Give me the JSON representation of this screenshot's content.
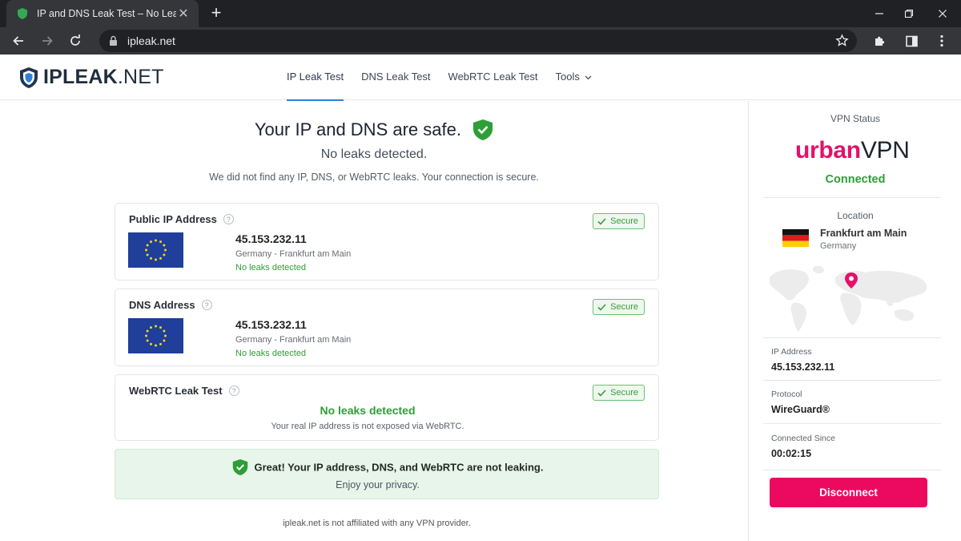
{
  "browser": {
    "tab_title": "IP and DNS Leak Test – No Leaks",
    "url": "ipleak.net"
  },
  "site": {
    "logo_prefix": "IPLEAK",
    "logo_suffix": ".NET",
    "nav": [
      {
        "label": "IP Leak Test",
        "active": true
      },
      {
        "label": "DNS Leak Test",
        "active": false
      },
      {
        "label": "WebRTC Leak Test",
        "active": false
      },
      {
        "label": "Tools",
        "active": false,
        "has_dropdown": true
      }
    ]
  },
  "hero": {
    "title": "Your IP and DNS are safe.",
    "subtitle": "No leaks detected.",
    "description": "We did not find any IP, DNS, or WebRTC leaks. Your connection is secure."
  },
  "cards": {
    "public_ip": {
      "title": "Public IP Address",
      "badge": "Secure",
      "ip": "45.153.232.11",
      "location": "Germany - Frankfurt am Main",
      "status": "No leaks detected"
    },
    "dns": {
      "title": "DNS Address",
      "badge": "Secure",
      "ip": "45.153.232.11",
      "location": "Germany - Frankfurt am Main",
      "status": "No leaks detected"
    },
    "webrtc": {
      "title": "WebRTC Leak Test",
      "badge": "Secure",
      "status": "No leaks detected",
      "note": "Your real IP address is not exposed via WebRTC."
    }
  },
  "success": {
    "headline": "Great! Your IP address, DNS, and WebRTC are not leaking.",
    "sub": "Enjoy your privacy."
  },
  "footer_note": "ipleak.net is not affiliated with any VPN provider.",
  "sidebar": {
    "vpn_status_label": "VPN Status",
    "brand_left": "urban",
    "brand_right": "VPN",
    "connection_status": "Connected",
    "location_label": "Location",
    "city": "Frankfurt am Main",
    "country": "Germany",
    "ip_label": "IP Address",
    "ip_value": "45.153.232.11",
    "protocol_label": "Protocol",
    "protocol_value": "WireGuard®",
    "since_label": "Connected Since",
    "since_value": "00:02:15",
    "disconnect_label": "Disconnect"
  },
  "colors": {
    "success_green": "#2e9e36",
    "brand_pink": "#ec0a61",
    "nav_active_underline": "#2f80d8",
    "chrome_dark": "#202124"
  }
}
